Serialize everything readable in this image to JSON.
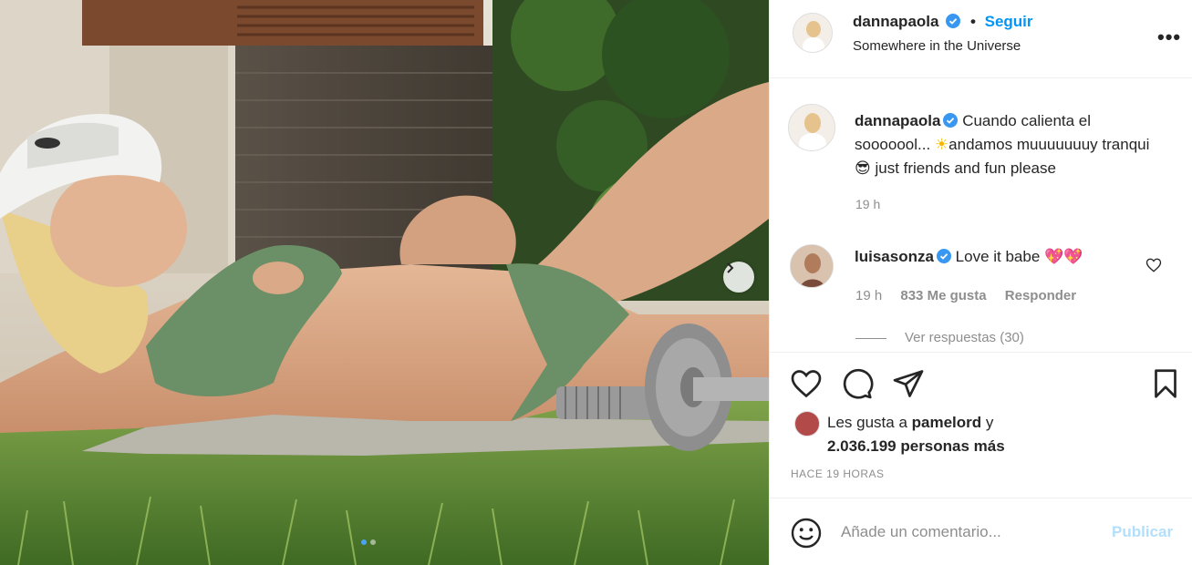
{
  "post": {
    "username": "dannapaola",
    "follow_label": "Seguir",
    "separator": "•",
    "location": "Somewhere in the Universe",
    "more_label": "•••"
  },
  "caption": {
    "username": "dannapaola",
    "text_part1": "Cuando calienta el sooooool...",
    "sun_emoji": "☀",
    "text_part2": "andamos muuuuuuuy tranqui",
    "sunglasses_emoji": "😎",
    "text_part3": "just friends and fun please",
    "time": "19 h"
  },
  "comment": {
    "username": "luisasonza",
    "text": "Love it babe",
    "hearts_emoji": "💖💖",
    "time": "19 h",
    "likes": "833 Me gusta",
    "reply_label": "Responder",
    "view_replies": "Ver respuestas (30)"
  },
  "likes": {
    "prefix": "Les gusta a",
    "user": "pamelord",
    "joiner": "y",
    "count_text": "2.036.199 personas más"
  },
  "timeago": "HACE 19 HORAS",
  "add_comment": {
    "placeholder": "Añade un comentario...",
    "publish_label": "Publicar"
  },
  "carousel": {
    "current_index": 1,
    "total": 2
  },
  "colors": {
    "accent": "#0095f6",
    "publish_disabled": "#b2dffc",
    "secondary_text": "#8e8e8e",
    "verified": "#3897f0"
  },
  "icons": {
    "verified": "verified-badge-icon",
    "next": "chevron-right-icon",
    "like": "heart-icon",
    "comment": "comment-bubble-icon",
    "share": "paper-plane-icon",
    "save": "bookmark-icon",
    "emoji": "smiley-icon"
  }
}
